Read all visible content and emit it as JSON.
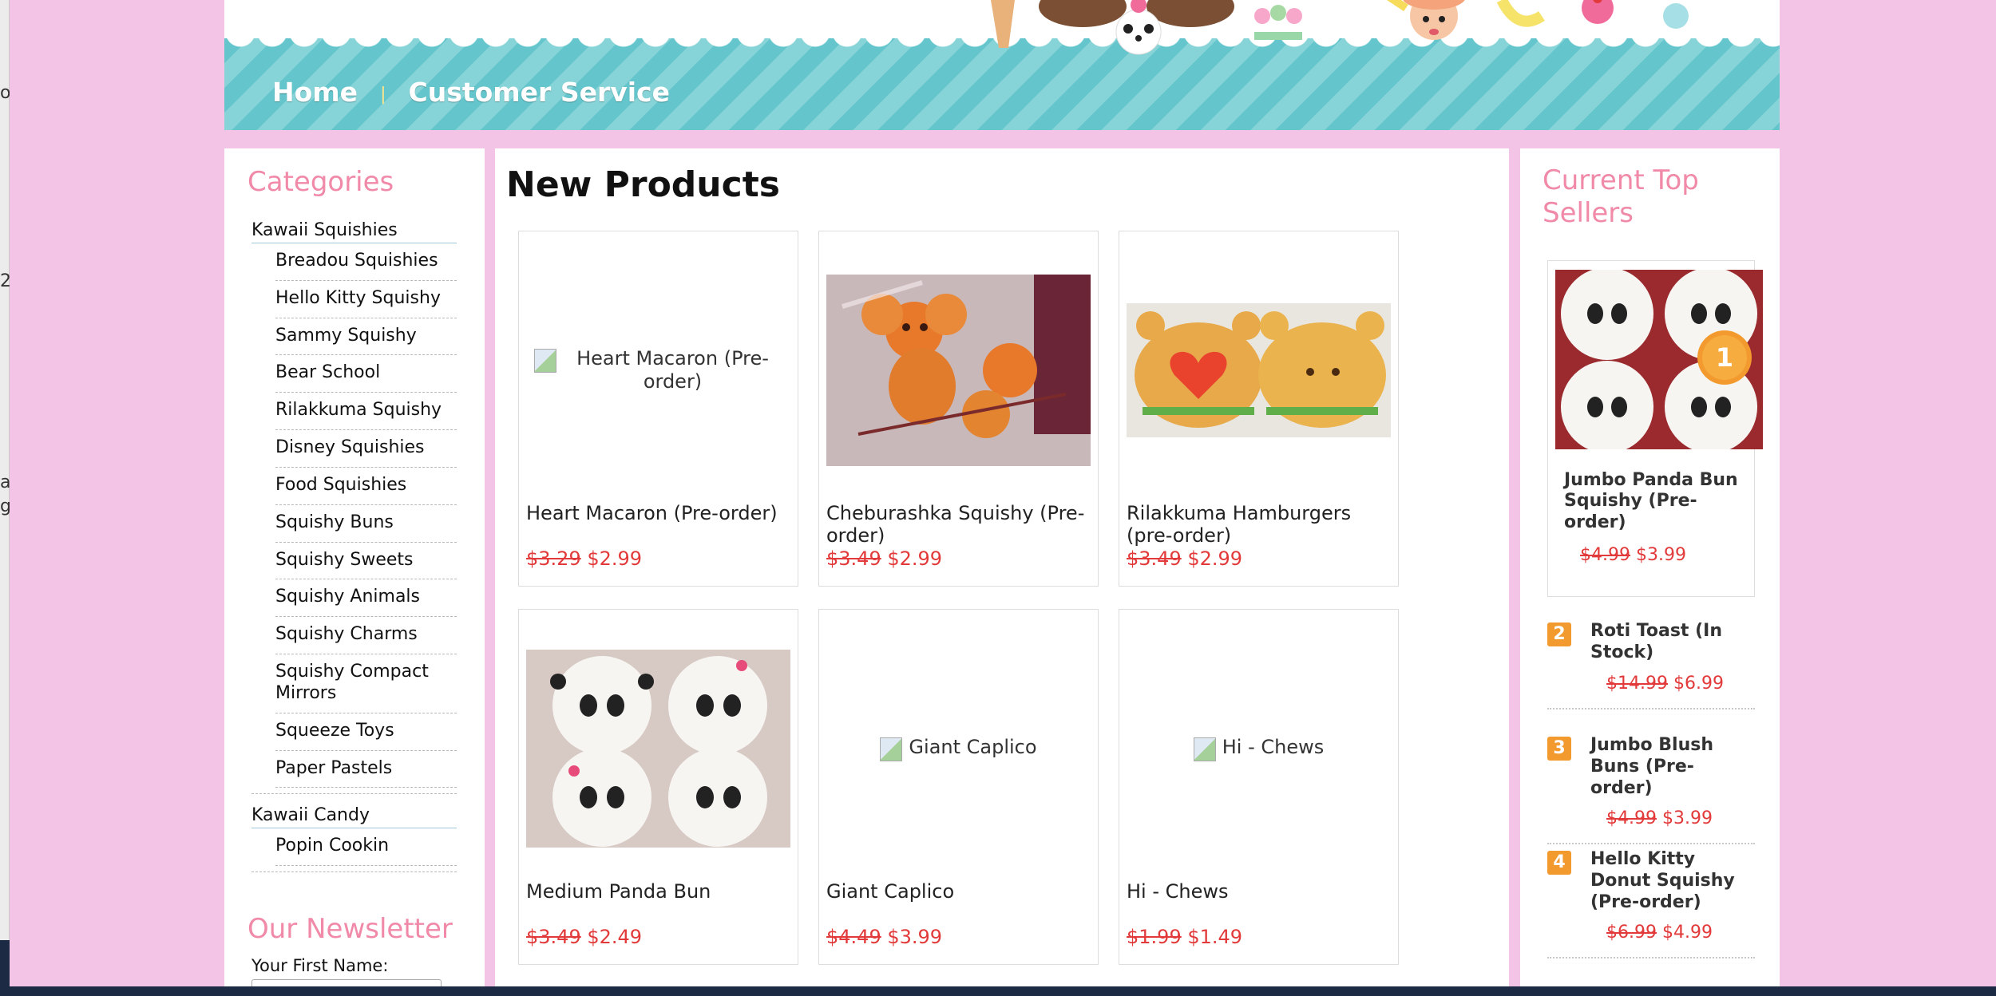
{
  "background_color": "#f4c4e6",
  "accent_pink": "#f08aa8",
  "price_red": "#e23a3a",
  "nav": {
    "home": "Home",
    "separator": "|",
    "customer_service": "Customer Service"
  },
  "side_strip": {
    "fragments": [
      "o",
      "2",
      "a",
      "g"
    ]
  },
  "categories": {
    "title": "Categories",
    "groups": [
      {
        "label": "Kawaii Squishies",
        "items": [
          "Breadou Squishies",
          "Hello Kitty Squishy",
          "Sammy Squishy",
          "Bear School",
          "Rilakkuma Squishy",
          "Disney Squishies",
          "Food Squishies",
          "Squishy Buns",
          "Squishy Sweets",
          "Squishy Animals",
          "Squishy Charms",
          "Squishy Compact Mirrors",
          "Squeeze Toys",
          "Paper Pastels"
        ]
      },
      {
        "label": "Kawaii Candy",
        "items": [
          "Popin Cookin"
        ]
      }
    ]
  },
  "newsletter": {
    "title": "Our Newsletter",
    "first_name_label": "Your First Name:",
    "first_name_value": ""
  },
  "new_products": {
    "title": "New Products",
    "items": [
      {
        "name": "Heart Macaron (Pre-order)",
        "old_price": "$3.29",
        "new_price": "$2.99",
        "image": "broken",
        "alt": "Heart Macaron (Pre-order)"
      },
      {
        "name": "Cheburashka Squishy (Pre-order)",
        "old_price": "$3.49",
        "new_price": "$2.99",
        "image": "cheburashka-photo"
      },
      {
        "name": "Rilakkuma Hamburgers (pre-order)",
        "old_price": "$3.49",
        "new_price": "$2.99",
        "image": "hamburger-photo"
      },
      {
        "name": "Medium Panda Bun",
        "old_price": "$3.49",
        "new_price": "$2.49",
        "image": "panda-photo"
      },
      {
        "name": "Giant Caplico",
        "old_price": "$4.49",
        "new_price": "$3.99",
        "image": "broken",
        "alt": "Giant Caplico"
      },
      {
        "name": "Hi - Chews",
        "old_price": "$1.99",
        "new_price": "$1.49",
        "image": "broken",
        "alt": "Hi - Chews"
      }
    ]
  },
  "top_sellers": {
    "title_line1": "Current Top",
    "title_line2": "Sellers",
    "featured": {
      "rank": "1",
      "name": "Jumbo Panda Bun Squishy (Pre-order)",
      "old_price": "$4.99",
      "new_price": "$3.99"
    },
    "items": [
      {
        "rank": "2",
        "name": "Roti Toast (In Stock)",
        "old_price": "$14.99",
        "new_price": "$6.99"
      },
      {
        "rank": "3",
        "name": "Jumbo Blush Buns (Pre-order)",
        "old_price": "$4.99",
        "new_price": "$3.99"
      },
      {
        "rank": "4",
        "name": "Hello Kitty Donut Squishy (Pre-order)",
        "old_price": "$6.99",
        "new_price": "$4.99"
      }
    ]
  }
}
